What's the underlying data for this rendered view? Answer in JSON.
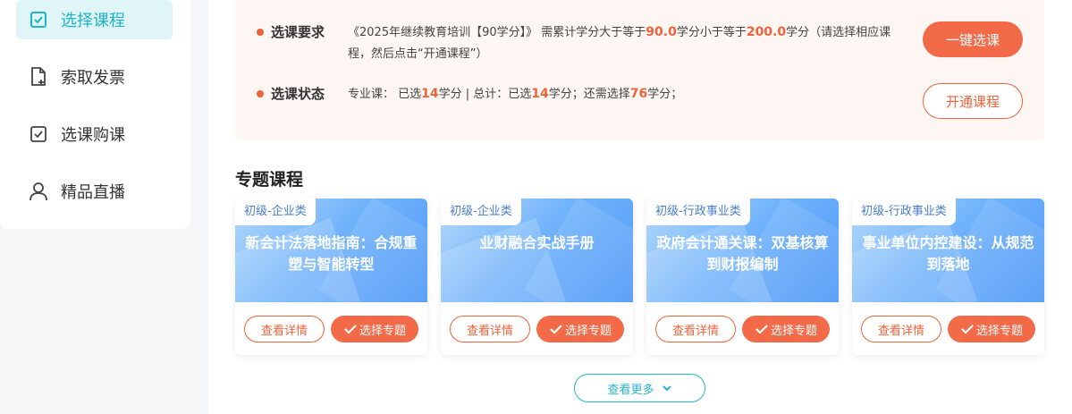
{
  "sidebar": {
    "items": [
      {
        "label": "选择课程",
        "icon": "checkbox-icon",
        "active": true
      },
      {
        "label": "索取发票",
        "icon": "file-add-icon",
        "active": false
      },
      {
        "label": "选课购课",
        "icon": "checkbox-icon",
        "active": false
      },
      {
        "label": "精品直播",
        "icon": "user-icon",
        "active": false
      }
    ]
  },
  "requirement": {
    "title": "选课要求",
    "text_pre": "《2025年继续教育培训【90学分】》 需累计学分大于等于",
    "min_credits": "90.0",
    "text_mid": "学分小于等于",
    "max_credits": "200.0",
    "text_post": "学分（请选择相应课程，然后点击“开通课程”）"
  },
  "status": {
    "title": "选课状态",
    "text_1": "专业课： 已选",
    "pro_selected": "14",
    "text_2": "学分 | 总计：已选",
    "total_selected": "14",
    "text_3": "学分；还需选择",
    "remaining": "76",
    "text_4": "学分；"
  },
  "buttons": {
    "one_click": "一键选课",
    "open_course": "开通课程",
    "view_more": "查看更多"
  },
  "section_title": "专题课程",
  "cards": [
    {
      "tag": "初级-企业类",
      "title": "新会计法落地指南：合规重塑与智能转型",
      "detail": "查看详情",
      "select": "选择专题"
    },
    {
      "tag": "初级-企业类",
      "title": "业财融合实战手册",
      "detail": "查看详情",
      "select": "选择专题"
    },
    {
      "tag": "初级-行政事业类",
      "title": "政府会计通关课：双基核算到财报编制",
      "detail": "查看详情",
      "select": "选择专题"
    },
    {
      "tag": "初级-行政事业类",
      "title": "事业单位内控建设：从规范到落地",
      "detail": "查看详情",
      "select": "选择专题"
    }
  ],
  "colors": {
    "accent_orange": "#f26a47",
    "accent_teal": "#21b3c6"
  }
}
